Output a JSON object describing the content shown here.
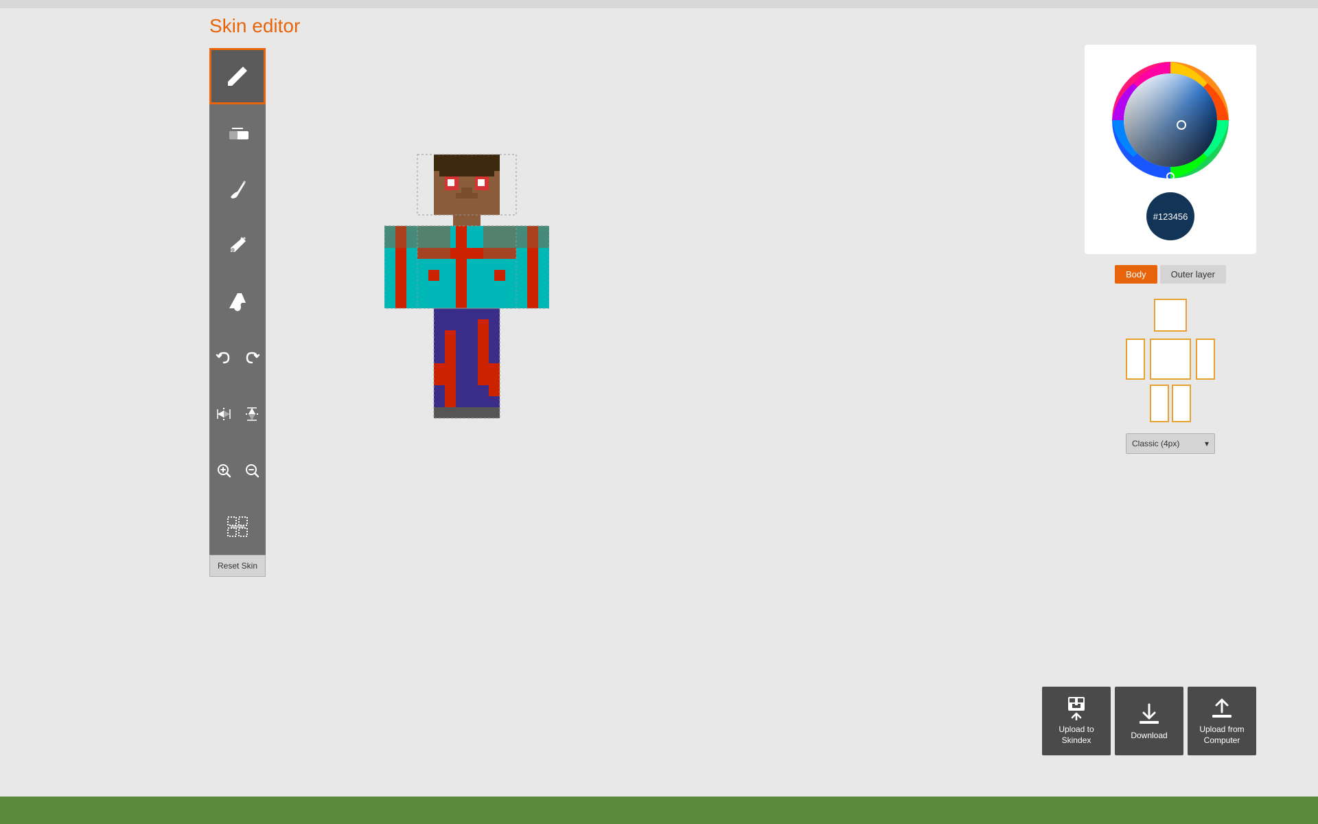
{
  "page": {
    "title": "Skin editor",
    "bg_color": "#e8e8e8"
  },
  "toolbar": {
    "tools": [
      {
        "id": "pencil",
        "label": "Pencil",
        "active": true
      },
      {
        "id": "eraser",
        "label": "Eraser",
        "active": false
      },
      {
        "id": "brush",
        "label": "Brush",
        "active": false
      },
      {
        "id": "eyedropper",
        "label": "Eyedropper",
        "active": false
      },
      {
        "id": "fill",
        "label": "Fill",
        "active": false
      }
    ],
    "undo_label": "Undo",
    "redo_label": "Redo",
    "mirror_h_label": "Mirror Horizontal",
    "mirror_v_label": "Mirror Vertical",
    "zoom_in_label": "Zoom In",
    "zoom_out_label": "Zoom Out",
    "grid_label": "Grid",
    "reset_skin_label": "Reset Skin"
  },
  "color_picker": {
    "hex_value": "#123456",
    "bg_color": "white"
  },
  "layers": {
    "body_label": "Body",
    "outer_layer_label": "Outer layer"
  },
  "skin_selector": {
    "dropdown_label": "Classic (4px)",
    "dropdown_arrow": "▾"
  },
  "actions": {
    "upload_skindex_label": "Upload to\nSkindex",
    "download_label": "Download",
    "upload_computer_label": "Upload from\nComputer"
  },
  "bottom_bar": {
    "color": "#5a8a3a"
  }
}
